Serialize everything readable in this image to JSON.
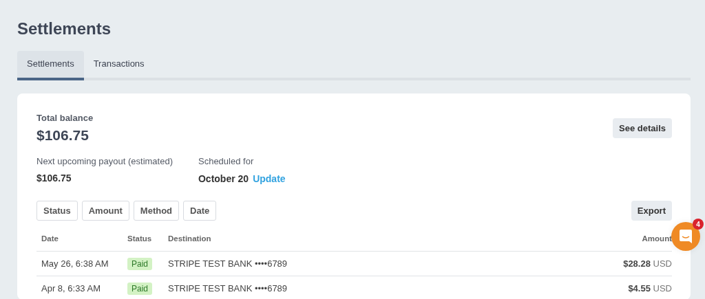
{
  "page_title": "Settlements",
  "tabs": [
    {
      "label": "Settlements",
      "selected": true
    },
    {
      "label": "Transactions",
      "selected": false
    }
  ],
  "balance": {
    "label": "Total balance",
    "amount": "$106.75",
    "details_button": "See details"
  },
  "payout": {
    "label": "Next upcoming payout (estimated)",
    "amount": "$106.75"
  },
  "schedule": {
    "label": "Scheduled for",
    "date": "October 20",
    "link": "Update"
  },
  "filters": [
    "Status",
    "Amount",
    "Method",
    "Date"
  ],
  "export_button": "Export",
  "table": {
    "columns": [
      "Date",
      "Status",
      "Destination",
      "Amount"
    ],
    "rows": [
      {
        "date": "May 26, 6:38 AM",
        "status": "Paid",
        "destination": "STRIPE TEST BANK ••••6789",
        "amount": "$28.28",
        "currency": "USD"
      },
      {
        "date": "Apr 8, 6:33 AM",
        "status": "Paid",
        "destination": "STRIPE TEST BANK ••••6789",
        "amount": "$4.55",
        "currency": "USD"
      }
    ]
  },
  "chat": {
    "badge": "4"
  }
}
